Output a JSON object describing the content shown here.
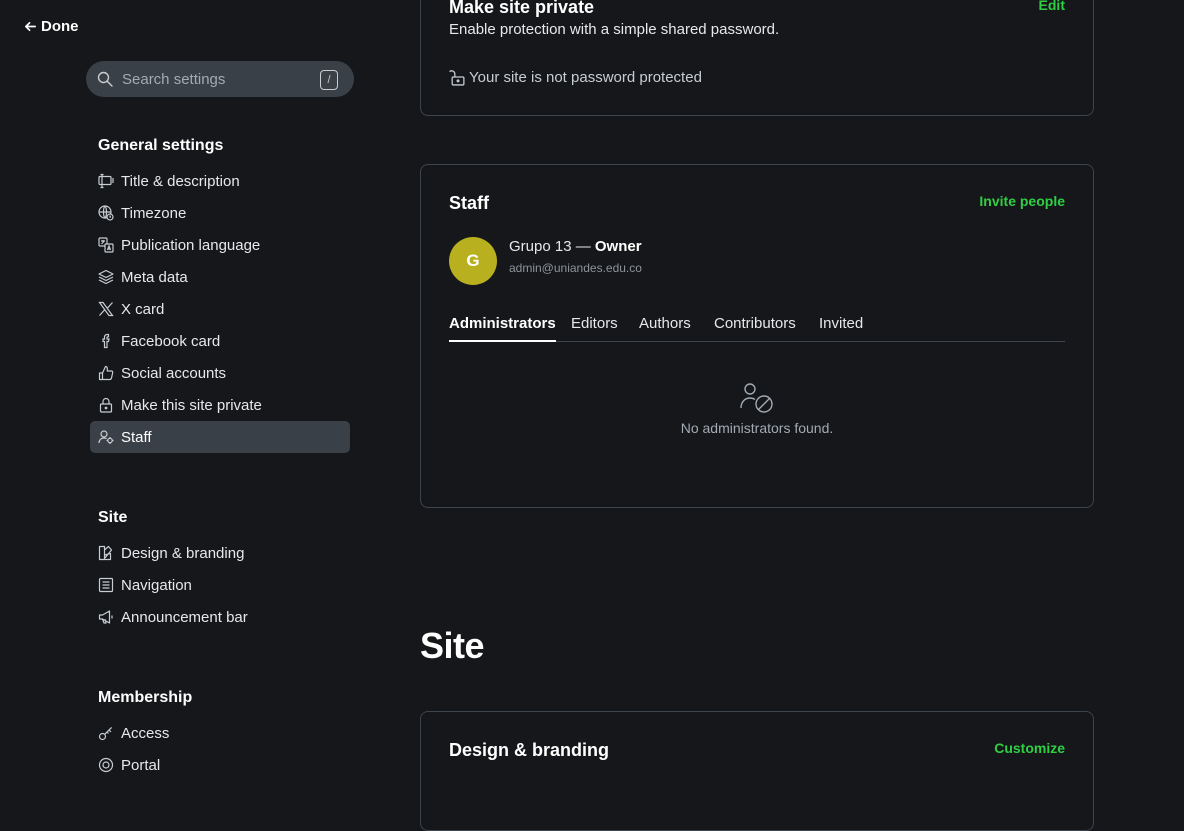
{
  "nav": {
    "done_label": "Done",
    "search": {
      "placeholder": "Search settings",
      "shortcut": "/"
    },
    "groups": [
      {
        "heading": "General settings",
        "items": [
          {
            "label": "Title & description",
            "icon": "title-icon"
          },
          {
            "label": "Timezone",
            "icon": "globe-icon"
          },
          {
            "label": "Publication language",
            "icon": "language-icon"
          },
          {
            "label": "Meta data",
            "icon": "layers-icon"
          },
          {
            "label": "X card",
            "icon": "x-logo-icon"
          },
          {
            "label": "Facebook card",
            "icon": "facebook-icon"
          },
          {
            "label": "Social accounts",
            "icon": "thumbs-up-icon"
          },
          {
            "label": "Make this site private",
            "icon": "lock-icon"
          },
          {
            "label": "Staff",
            "icon": "staff-icon",
            "active": true
          }
        ]
      },
      {
        "heading": "Site",
        "items": [
          {
            "label": "Design & branding",
            "icon": "paintbrush-icon"
          },
          {
            "label": "Navigation",
            "icon": "navigation-icon"
          },
          {
            "label": "Announcement bar",
            "icon": "megaphone-icon"
          }
        ]
      },
      {
        "heading": "Membership",
        "items": [
          {
            "label": "Access",
            "icon": "key-icon"
          },
          {
            "label": "Portal",
            "icon": "portal-icon"
          }
        ]
      }
    ]
  },
  "private_card": {
    "title": "Make site private",
    "edit_label": "Edit",
    "description": "Enable protection with a simple shared password.",
    "status": "Your site is not password protected"
  },
  "staff_card": {
    "title": "Staff",
    "invite_label": "Invite people",
    "owner": {
      "initial": "G",
      "name": "Grupo 13",
      "separator": " — ",
      "role": "Owner",
      "email": "admin@uniandes.edu.co"
    },
    "tabs": [
      "Administrators",
      "Editors",
      "Authors",
      "Contributors",
      "Invited"
    ],
    "active_tab": "Administrators",
    "empty_message": "No administrators found."
  },
  "site_section": {
    "title": "Site",
    "design_card": {
      "title": "Design & branding",
      "action_label": "Customize"
    }
  },
  "colors": {
    "background": "#15171a",
    "accent_green": "#30cf43",
    "avatar": "#b9b01f",
    "active_item": "#394047"
  }
}
